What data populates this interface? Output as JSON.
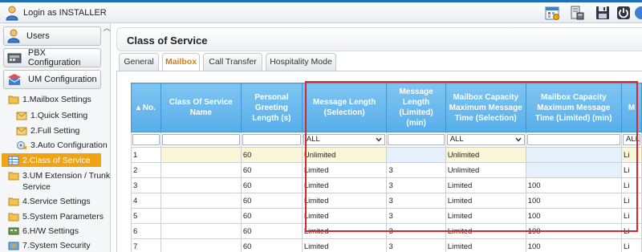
{
  "topbar": {
    "login_text": "Login as INSTALLER",
    "icons": [
      "calendar-icon",
      "phone-book-icon",
      "save-icon",
      "power-icon",
      "help-icon"
    ]
  },
  "sidebar": {
    "menu": [
      {
        "label": "Users",
        "icon": "user-icon"
      },
      {
        "label": "PBX Configuration",
        "icon": "pbx-icon"
      },
      {
        "label": "UM Configuration",
        "icon": "um-icon"
      }
    ],
    "tree": [
      {
        "label": "1.Mailbox Settings",
        "icon": "folder-open-icon"
      },
      {
        "label": "1.Quick Setting",
        "icon": "mail-icon"
      },
      {
        "label": "2.Full Setting",
        "icon": "mail-icon"
      },
      {
        "label": "3.Auto Configuration",
        "icon": "auto-config-icon"
      },
      {
        "label": "2.Class of Service",
        "icon": "grid-icon"
      },
      {
        "label": "3.UM Extension / Trunk",
        "label2": "Service",
        "icon": "folder-icon"
      },
      {
        "label": "4.Service Settings",
        "icon": "folder-icon"
      },
      {
        "label": "5.System Parameters",
        "icon": "folder-icon"
      },
      {
        "label": "6.H/W Settings",
        "icon": "hw-icon"
      },
      {
        "label": "7.System Security",
        "icon": "security-icon"
      }
    ]
  },
  "page": {
    "title": "Class of Service",
    "tabs": [
      "General",
      "Mailbox",
      "Call Transfer",
      "Hospitality Mode"
    ],
    "active_tab": "Mailbox"
  },
  "grid": {
    "headers": [
      "No.",
      "Class Of Service Name",
      "Personal Greeting Length (s)",
      "Message Length (Selection)",
      "Message Length (Limited) (min)",
      "Mailbox Capacity Maximum Message Time (Selection)",
      "Mailbox Capacity Maximum Message Time (Limited) (min)",
      "M"
    ],
    "filter_all": "ALL",
    "rows": [
      {
        "no": "1",
        "name": "",
        "greet": "60",
        "msg_sel": "Unlimited",
        "msg_lim": "",
        "cap_sel": "Unlimited",
        "cap_lim": "",
        "extra": "Li"
      },
      {
        "no": "2",
        "name": "",
        "greet": "60",
        "msg_sel": "Limited",
        "msg_lim": "3",
        "cap_sel": "Unlimited",
        "cap_lim": "",
        "extra": "Li"
      },
      {
        "no": "3",
        "name": "",
        "greet": "60",
        "msg_sel": "Limited",
        "msg_lim": "3",
        "cap_sel": "Limited",
        "cap_lim": "100",
        "extra": "Li"
      },
      {
        "no": "4",
        "name": "",
        "greet": "60",
        "msg_sel": "Limited",
        "msg_lim": "3",
        "cap_sel": "Limited",
        "cap_lim": "100",
        "extra": "Li"
      },
      {
        "no": "5",
        "name": "",
        "greet": "60",
        "msg_sel": "Limited",
        "msg_lim": "3",
        "cap_sel": "Limited",
        "cap_lim": "100",
        "extra": "Li"
      },
      {
        "no": "6",
        "name": "",
        "greet": "60",
        "msg_sel": "Limited",
        "msg_lim": "3",
        "cap_sel": "Limited",
        "cap_lim": "100",
        "extra": "Li"
      },
      {
        "no": "7",
        "name": "",
        "greet": "60",
        "msg_sel": "Limited",
        "msg_lim": "3",
        "cap_sel": "Limited",
        "cap_lim": "100",
        "extra": "Li"
      }
    ]
  },
  "colors": {
    "header_blue": "#58aee9",
    "selected_orange": "#f0a314",
    "active_tab_text": "#e07b00",
    "highlight_red": "#d8262e"
  }
}
